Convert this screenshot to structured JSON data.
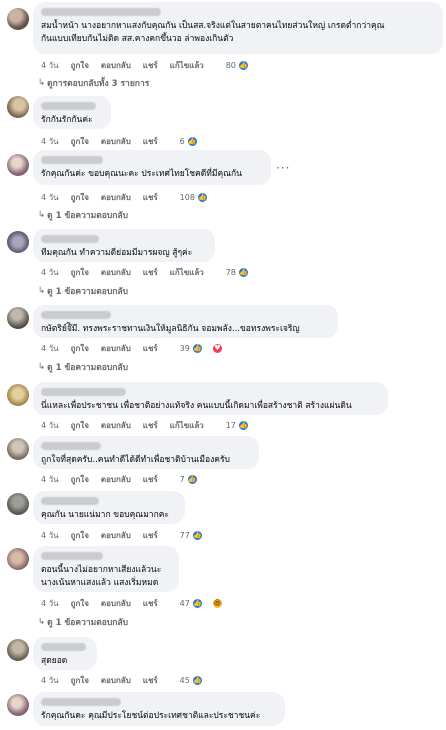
{
  "actions": {
    "like": "ถูกใจ",
    "reply": "ตอบกลับ",
    "share": "แชร์",
    "edited": "แก้ไขแล้ว"
  },
  "more_glyph": "···",
  "comments": [
    {
      "lines": [
        "สมน้ำหน้า นางอยากหาแสงกับคุณกัน เป็นสส.จริงแต่ในสายตาคนไทยส่วนใหญ่ เกรดต่ำกว่าคุณ",
        "กันแบบเทียบกันไม่ติด สส.คางคกขึ้นวอ ล่าพองเกินตัว"
      ],
      "time": "4 วัน",
      "edited": true,
      "reactions": "80",
      "react_types": [
        "like"
      ],
      "replies": "ดูการตอบกลับทั้ง 3 รายการ"
    },
    {
      "lines": [
        "รักกันรักกันค่ะ"
      ],
      "time": "4 วัน",
      "edited": false,
      "reactions": "6",
      "react_types": [
        "like"
      ],
      "replies": ""
    },
    {
      "lines": [
        "รักคุณกันค่ะ ขอบคุณนะคะ ประเทศไทยโชคดีที่มีคุณกัน"
      ],
      "time": "4 วัน",
      "edited": false,
      "reactions": "108",
      "react_types": [
        "like"
      ],
      "replies": "ดู 1 ข้อความตอบกลับ"
    },
    {
      "lines": [
        "ทีมคุณกัน ทำความดีย่อมมีมารผจญ สู้ๆค่ะ"
      ],
      "time": "4 วัน",
      "edited": true,
      "reactions": "78",
      "react_types": [
        "like"
      ],
      "replies": "ดู 1 ข้อความตอบกลับ"
    },
    {
      "lines": [
        "กษัตริย์จ๊ิมี. ทรงพระราชทานเงินให้มูลนิธิกัน จอมพลัง...ขอทรงพระเจริญ"
      ],
      "time": "4 วัน",
      "edited": false,
      "reactions": "39",
      "react_types": [
        "like",
        "love"
      ],
      "replies": "ดู 1 ข้อความตอบกลับ"
    },
    {
      "lines": [
        "นี่แหละเพื่อประชาชน เพื่อชาติอย่างแท้จริง คนแบบนี้เกิดมาเพื่อสร้างชาติ สร้างแผ่นดิน"
      ],
      "time": "4 วัน",
      "edited": true,
      "reactions": "17",
      "react_types": [
        "like"
      ],
      "replies": ""
    },
    {
      "lines": [
        "ถูกใจที่สุดครับ..คนทำดีได้ดีทำเพื่อชาติบ้านเมืองครับ"
      ],
      "time": "4 วัน",
      "edited": false,
      "reactions": "7",
      "react_types": [
        "like"
      ],
      "replies": ""
    },
    {
      "lines": [
        "คุณกัน นายแน่มาก ขอบคุณมากคะ"
      ],
      "time": "4 วัน",
      "edited": false,
      "reactions": "77",
      "react_types": [
        "like"
      ],
      "replies": ""
    },
    {
      "lines": [
        "ตอนนี้นางไม่อยากหาเสียงแล้วนะ",
        "นางเน้นหาแสงแล้ว แสงเริ่มหมด"
      ],
      "time": "4 วัน",
      "edited": false,
      "reactions": "47",
      "react_types": [
        "like",
        "haha"
      ],
      "replies": "ดู 1 ข้อความตอบกลับ"
    },
    {
      "lines": [
        "สุดยอด"
      ],
      "time": "4 วัน",
      "edited": false,
      "reactions": "45",
      "react_types": [
        "like"
      ],
      "replies": ""
    },
    {
      "lines": [
        "รักคุณกันคะ คุณมีประโยชน์ต่อประเทศชาติและประชาชนค่ะ"
      ],
      "time": "",
      "edited": false,
      "reactions": "",
      "react_types": [],
      "replies": ""
    }
  ]
}
